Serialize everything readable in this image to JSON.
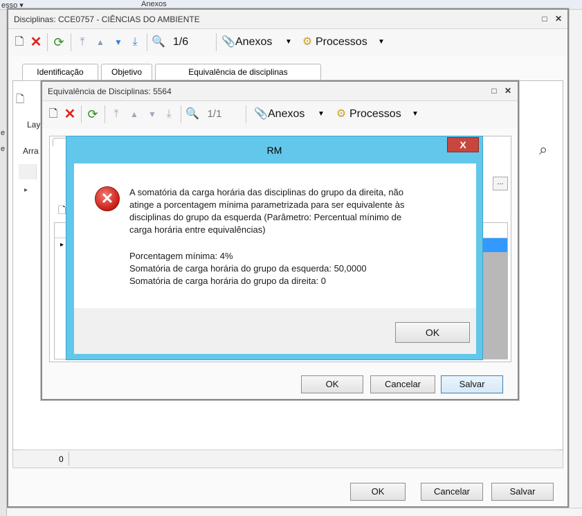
{
  "background": {
    "top_left_text": "esso ▾",
    "top_tab_text": "Anexos"
  },
  "outer": {
    "title": "Disciplinas: CCE0757 - CIÊNCIAS DO AMBIENTE",
    "record_counter": "1/6",
    "anexos_label": "Anexos",
    "processos_label": "Processos",
    "tabs": [
      "Identificação",
      "Objetivo",
      "Equivalência de disciplinas"
    ],
    "left_labels": [
      "Lay",
      "Arra"
    ],
    "count_value": "0",
    "buttons": {
      "ok": "OK",
      "cancel": "Cancelar",
      "save": "Salvar"
    }
  },
  "inner": {
    "title": "Equivalência de Disciplinas: 5564",
    "record_counter": "1/1",
    "anexos_label": "Anexos",
    "processos_label": "Processos",
    "buttons": {
      "ok": "OK",
      "cancel": "Cancelar",
      "save": "Salvar"
    }
  },
  "dialog": {
    "title": "RM",
    "close_glyph": "X",
    "message_lines": [
      "A somatória da carga horária das disciplinas do grupo da direita, não",
      "atinge a porcentagem mínima parametrizada para ser equivalente às",
      "disciplinas do grupo da esquerda (Parâmetro: Percentual mínimo de",
      "carga horária entre equivalências)"
    ],
    "detail_lines": [
      "Porcentagem mínima: 4%",
      "Somatória de carga horária do grupo da esquerda: 50,0000",
      "Somatória de carga horária do grupo da direita: 0"
    ],
    "ok_label": "OK"
  },
  "colors": {
    "dialog_frame": "#62c7ea",
    "error_red": "#c81d14",
    "close_button": "#c7463d",
    "selection_blue": "#3399ff"
  }
}
